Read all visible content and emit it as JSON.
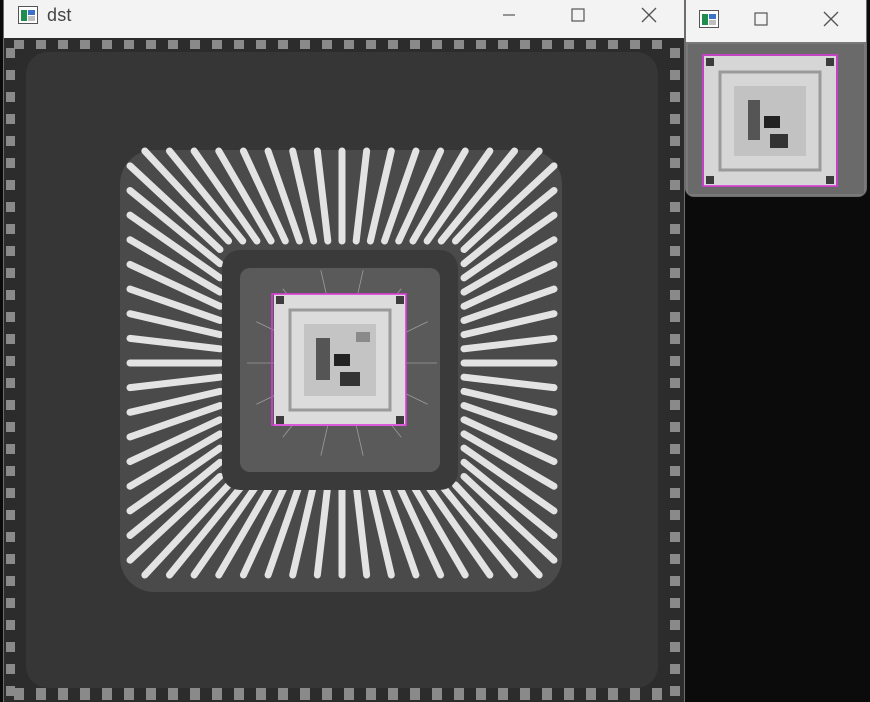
{
  "main_window": {
    "title": "dst",
    "icon": "opencv-window-icon",
    "controls": [
      "minimize-icon",
      "maximize-icon",
      "close-icon"
    ],
    "roi_color": "#d93ad9"
  },
  "preview_window": {
    "title": "",
    "icon": "opencv-window-icon",
    "controls": [
      "maximize-icon",
      "close-icon"
    ],
    "roi_color": "#d93ad9"
  },
  "colors": {
    "titlebar": "#f3f3f3",
    "desktop": "#0b0b0b",
    "chip_board": "#363636",
    "leads": "#e3e3e3"
  }
}
